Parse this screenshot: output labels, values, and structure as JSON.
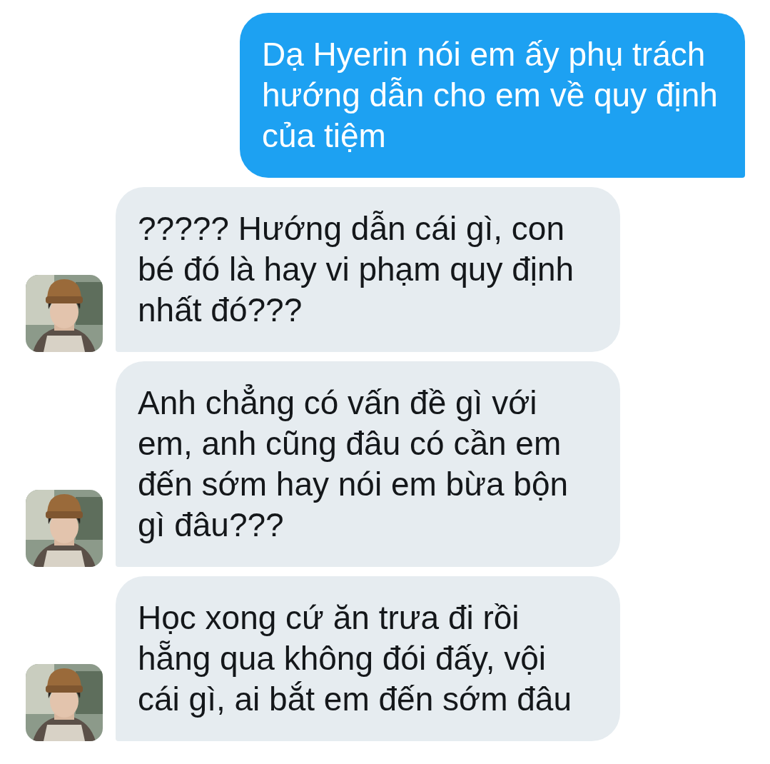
{
  "messages": [
    {
      "kind": "outgoing",
      "text": "Dạ Hyerin nói em ấy phụ trách hướng dẫn cho em về quy định của tiệm",
      "avatar": false
    },
    {
      "kind": "incoming",
      "text": "????? Hướng dẫn cái gì, con bé đó là hay vi phạm quy định nhất đó???",
      "avatar": true
    },
    {
      "kind": "incoming",
      "text": "Anh chẳng có vấn đề gì với em, anh cũng đâu có cần em đến sớm hay nói em bừa bộn gì đâu???",
      "avatar": true
    },
    {
      "kind": "incoming",
      "text": "Học xong cứ ăn trưa đi rồi hẵng qua không đói đấy, vội cái gì, ai bắt em đến sớm đâu",
      "avatar": true
    }
  ]
}
